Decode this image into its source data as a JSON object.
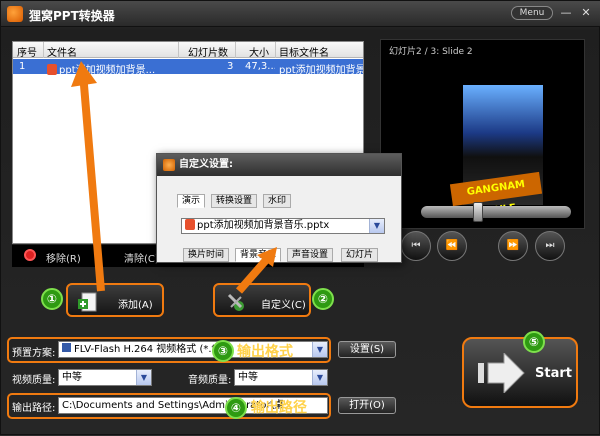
{
  "app": {
    "title": "狸窝PPT转换器",
    "menu_label": "Menu",
    "minimize_glyph": "—",
    "close_glyph": "✕"
  },
  "file_list": {
    "columns": [
      "序号",
      "文件名",
      "幻灯片数",
      "大小",
      "目标文件名"
    ],
    "rows": [
      {
        "index": "1",
        "filename": "ppt添加视频加背景...",
        "slides": "3",
        "size": "47,3...",
        "target": "ppt添加视频加背景..."
      }
    ]
  },
  "list_toolbar": {
    "remove_label": "移除(R)",
    "clear_label": "清除(C)"
  },
  "preview": {
    "label": "幻灯片2 / 3: Slide 2",
    "banner_text": "GANGNAM STYLE"
  },
  "actions": {
    "add_label": "添加(A)",
    "custom_label": "自定义(C)",
    "start_label": "Start"
  },
  "markers": [
    "①",
    "②",
    "③",
    "④",
    "⑤"
  ],
  "settings": {
    "preset_label": "预置方案:",
    "preset_value": "FLV-Flash H.264 视频格式 (*.flv)",
    "preset_button": "设置(S)",
    "video_quality_label": "视频质量:",
    "video_quality_value": "中等",
    "audio_quality_label": "音频质量:",
    "audio_quality_value": "中等",
    "output_path_label": "输出路径:",
    "output_path_value": "C:\\Documents and Settings\\Administrator\\桌",
    "open_button": "打开(O)"
  },
  "annotations": {
    "output_format": "输出格式",
    "output_path": "输出路径"
  },
  "dialog": {
    "title": "自定义设置:",
    "tabs": [
      "演示",
      "转换设置",
      "水印"
    ],
    "file_value": "ppt添加视频加背景音乐.pptx",
    "subtabs": [
      "换片时间",
      "背景音乐",
      "声音设置",
      "幻灯片"
    ]
  },
  "colors": {
    "accent_orange": "#f07a10",
    "marker_green": "#2e9a12",
    "selection_blue": "#3a6fd3"
  }
}
